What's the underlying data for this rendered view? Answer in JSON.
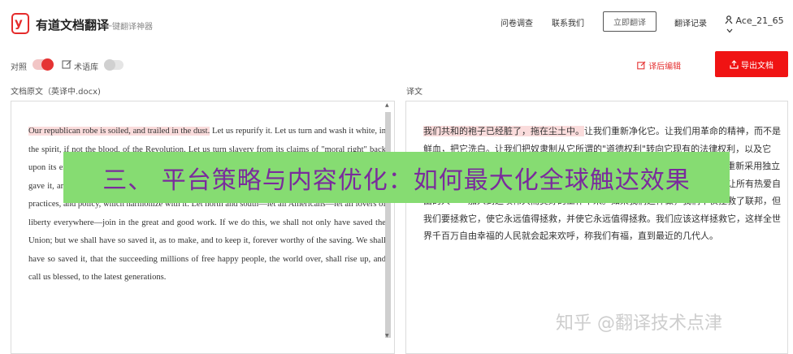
{
  "header": {
    "logo_glyph": "y",
    "brand": "有道文档翻译",
    "tagline": "一键翻译神器",
    "nav": [
      "问卷调查",
      "联系我们"
    ],
    "translate_button": "立即翻译",
    "history": "翻译记录",
    "user": "Ace_21_65",
    "user_icon": "user-icon",
    "chevron_icon": "chevron-down-icon"
  },
  "toolbar": {
    "compare_label": "对照",
    "compare_on": true,
    "glossary_label": "术语库",
    "glossary_on": false,
    "edit_after": "译后编辑",
    "export": "导出文档"
  },
  "source": {
    "label": "文档原文（英译中.docx)",
    "highlight": "Our republican robe is soiled, and trailed in the dust.",
    "text": " Let us repurify it. Let us turn and wash it white, in the spirit, if not the blood, of the Revolution. Let us turn slavery from its claims of \"moral right\" back upon its existing legal rights, and its arguments of \"necessity\". Let it return to the position our fathers gave it, and there let it rest in peace. Let us re-adopt the Declaration of Independence, and with it, the practices, and policy, which harmonize with it. Let north and south—let all Americans—let all lovers of liberty everywhere—join in the great and good work. If we do this, we shall not only have saved the Union; but we shall have so saved it, as to make, and to keep it, forever worthy of the saving. We shall have so saved it, that the succeeding millions of free happy people, the world over, shall rise up, and call us blessed, to the latest generations."
  },
  "target": {
    "label": "译文",
    "highlight": "我们共和的袍子已经脏了，拖在尘土中。",
    "text": "让我们重新净化它。让我们用革命的精神，而不是鲜血，把它洗白。让我们把奴隶制从它所谓的\"道德权利\"转向它现有的法律权利，以及它的\"必要性\"论点。让它回到我们父辈赋予它的位置，让它在那里安息。让我们重新采用独立宣言，以及与之相协调的做法和政策。让北方和南方——让所有的美国人——让所有热爱自由的人——加入到这项伟大而美好的工作中来。如果我们这样做，我们不仅拯救了联邦，但我们要拯救它，使它永远值得拯救，并使它永远值得拯救。我们应该这样拯救它，这样全世界千百万自由幸福的人民就会起来欢呼，称我们有福，直到最近的几代人。"
  },
  "banner": "三、 平台策略与内容优化：如何最大化全球触达效果",
  "watermark": "知乎 @翻译技术点津",
  "colors": {
    "accent": "#f01313",
    "highlight": "#fadcdc",
    "banner_bg": "#86dc72",
    "banner_text": "#7a2b9c"
  }
}
